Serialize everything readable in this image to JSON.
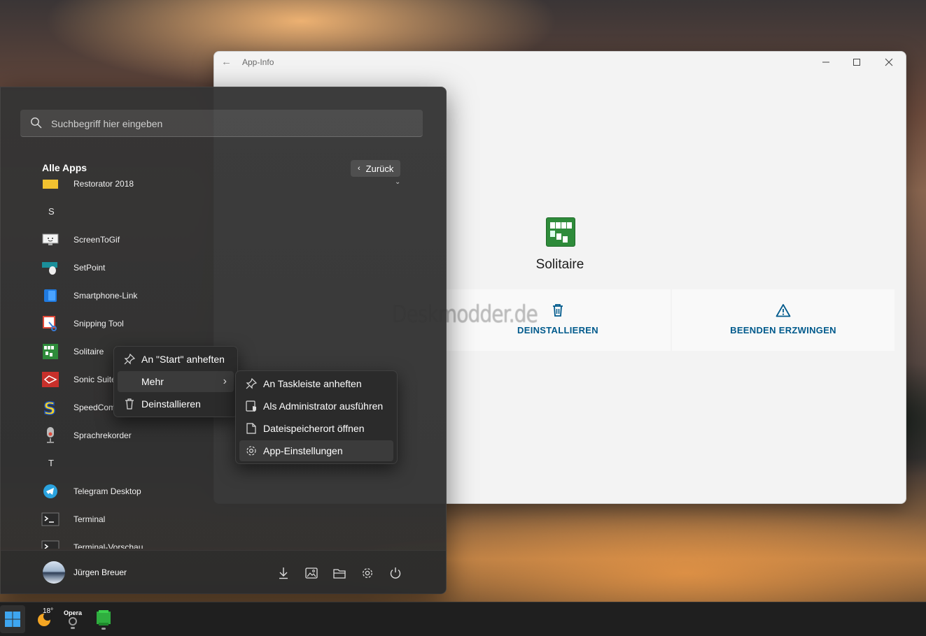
{
  "app_window": {
    "title": "App-Info",
    "app_name": "Solitaire",
    "actions": [
      {
        "label": "DEINSTALLIEREN",
        "icon": "trash-icon"
      },
      {
        "label": "BEENDEN ERZWINGEN",
        "icon": "warning-icon"
      }
    ]
  },
  "watermark": "Deskmodder.de",
  "start_menu": {
    "search_placeholder": "Suchbegriff hier eingeben",
    "section_title": "Alle Apps",
    "back_label": "Zurück",
    "apps": [
      {
        "label": "Restorator 2018",
        "icon": "folder-icon"
      },
      {
        "letter": "S"
      },
      {
        "label": "ScreenToGif",
        "icon": "monitor-icon"
      },
      {
        "label": "SetPoint",
        "icon": "mouse-icon"
      },
      {
        "label": "Smartphone-Link",
        "icon": "phone-icon"
      },
      {
        "label": "Snipping Tool",
        "icon": "scissors-icon"
      },
      {
        "label": "Solitaire",
        "icon": "cards-icon"
      },
      {
        "label": "Sonic Suite",
        "icon": "sonic-icon"
      },
      {
        "label": "SpeedCom",
        "icon": "speedcommander-icon"
      },
      {
        "label": "Sprachrekorder",
        "icon": "microphone-icon"
      },
      {
        "letter": "T"
      },
      {
        "label": "Telegram Desktop",
        "icon": "telegram-icon"
      },
      {
        "label": "Terminal",
        "icon": "terminal-icon"
      },
      {
        "label": "Terminal-Vorschau",
        "icon": "terminal-icon"
      }
    ],
    "user_name": "Jürgen Breuer"
  },
  "context_menu": {
    "items": [
      {
        "label": "An \"Start\" anheften",
        "icon": "pin-icon"
      },
      {
        "label": "Mehr",
        "icon": ""
      },
      {
        "label": "Deinstallieren",
        "icon": "trash-icon"
      }
    ]
  },
  "submenu": {
    "items": [
      {
        "label": "An Taskleiste anheften",
        "icon": "pin-icon"
      },
      {
        "label": "Als Administrator ausführen",
        "icon": "shield-icon"
      },
      {
        "label": "Dateispeicherort öffnen",
        "icon": "file-icon"
      },
      {
        "label": "App-Einstellungen",
        "icon": "gear-icon"
      }
    ]
  },
  "taskbar": {
    "weather_temp": "18°",
    "opera_label": "Opera"
  },
  "colors": {
    "accent_blue": "#005a8c",
    "solitaire_green": "#2e8b3a"
  }
}
